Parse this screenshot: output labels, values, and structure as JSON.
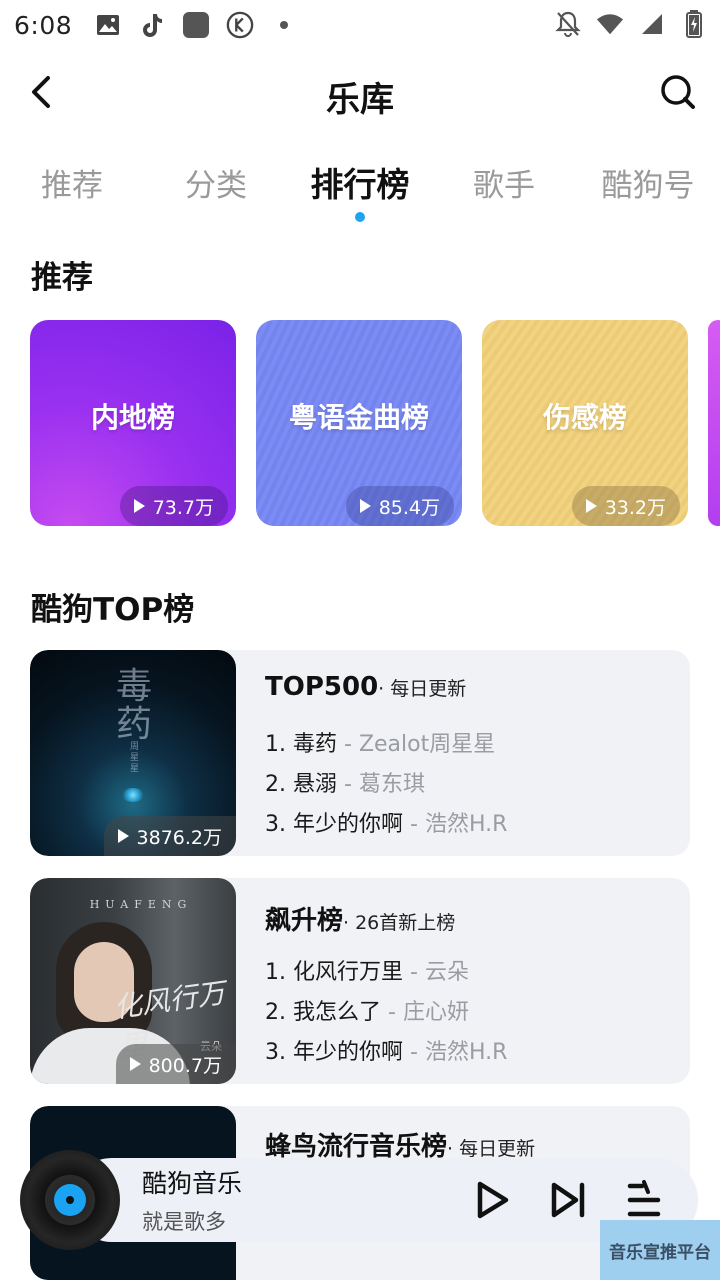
{
  "status_bar": {
    "time": "6:08",
    "left_icons": [
      "image-icon",
      "tiktok-icon",
      "app-square-icon",
      "k-circle-icon",
      "dot-icon"
    ],
    "right_icons": [
      "bell-off-icon",
      "wifi-icon",
      "signal-icon",
      "battery-charging-icon"
    ]
  },
  "header": {
    "title": "乐库"
  },
  "tabs": [
    {
      "label": "推荐",
      "active": false
    },
    {
      "label": "分类",
      "active": false
    },
    {
      "label": "排行榜",
      "active": true
    },
    {
      "label": "歌手",
      "active": false
    },
    {
      "label": "酷狗号",
      "active": false
    }
  ],
  "recommend": {
    "title": "推荐",
    "cards": [
      {
        "name": "内地榜",
        "plays": "73.7万"
      },
      {
        "name": "粤语金曲榜",
        "plays": "85.4万"
      },
      {
        "name": "伤感榜",
        "plays": "33.2万"
      }
    ]
  },
  "top": {
    "title": "酷狗TOP榜",
    "lists": [
      {
        "name": "TOP500",
        "sub": "· 每日更新",
        "plays": "3876.2万",
        "cover_text": "毒药",
        "cover_artist": "周星星",
        "songs": [
          {
            "rank": "1.",
            "title": "毒药",
            "artist": "- Zealot周星星"
          },
          {
            "rank": "2.",
            "title": "悬溺",
            "artist": "- 葛东琪"
          },
          {
            "rank": "3.",
            "title": "年少的你啊",
            "artist": "- 浩然H.R"
          }
        ]
      },
      {
        "name": "飙升榜",
        "sub": "· 26首新上榜",
        "plays": "800.7万",
        "cover_head": "HUAFENG",
        "cover_script": "化风行万里",
        "cover_artist": "云朵",
        "songs": [
          {
            "rank": "1.",
            "title": "化风行万里",
            "artist": "- 云朵"
          },
          {
            "rank": "2.",
            "title": "我怎么了",
            "artist": "- 庄心妍"
          },
          {
            "rank": "3.",
            "title": "年少的你啊",
            "artist": "- 浩然H.R"
          }
        ]
      },
      {
        "name": "蜂鸟流行音乐榜",
        "sub": "· 每日更新"
      }
    ]
  },
  "player": {
    "title": "酷狗音乐",
    "subtitle": "就是歌多"
  },
  "watermark": "音乐宣推平台",
  "colors": {
    "accent": "#1ea5f0",
    "card_bg": "#f1f2f6",
    "artist_gray": "#9a9ca4"
  }
}
